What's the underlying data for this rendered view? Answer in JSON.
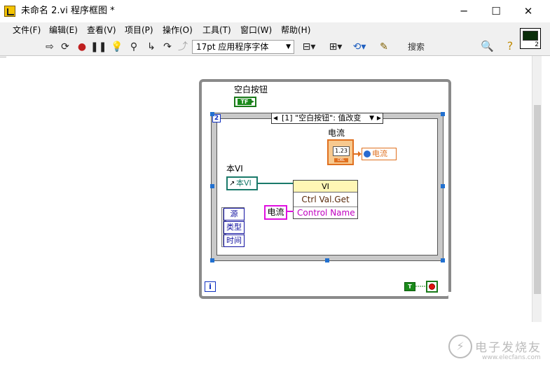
{
  "window": {
    "title": "未命名 2.vi 程序框图 *",
    "controls": [
      "─",
      "☐",
      "✕"
    ]
  },
  "menu": [
    "文件(F)",
    "编辑(E)",
    "查看(V)",
    "项目(P)",
    "操作(O)",
    "工具(T)",
    "窗口(W)",
    "帮助(H)"
  ],
  "toolbar": {
    "font": "17pt 应用程序字体",
    "search_placeholder": "搜索",
    "vi_icon_number": "2"
  },
  "diagram": {
    "event_case_label": "[1] \"空白按钮\": 值改变",
    "event_case_number": "2",
    "event_data": [
      "源",
      "类型",
      "时间"
    ],
    "boolean_label": "空白按钮",
    "boolean_tag": "TF",
    "numeric_label": "电流",
    "numeric_display": "1.23",
    "numeric_type": "DBL",
    "local_variable": "电流",
    "ref_label": "本VI",
    "ref_value": "本VI",
    "invoke_class": "VI",
    "invoke_method": "Ctrl Val.Get",
    "invoke_param": "Control Name",
    "string_const": "电流",
    "iteration": "i",
    "true_const": "T"
  },
  "watermark": {
    "logo": "⚡",
    "name": "电子发烧友",
    "url": "www.elecfans.com"
  }
}
